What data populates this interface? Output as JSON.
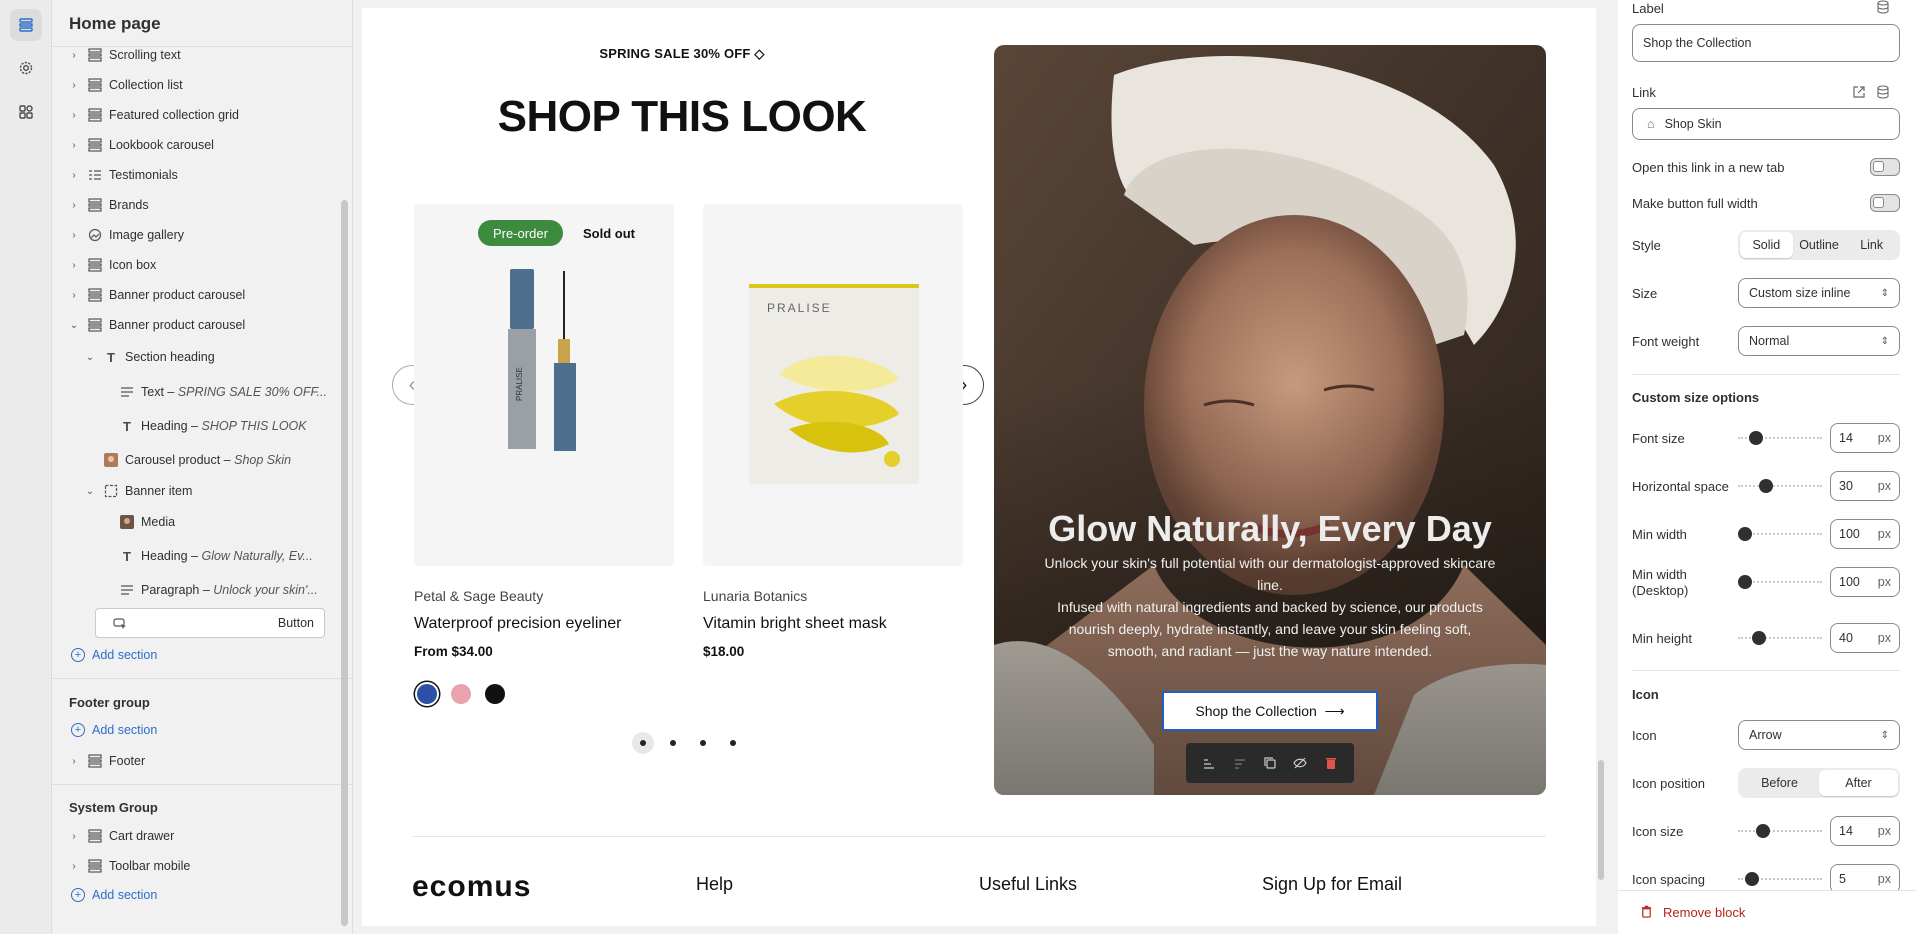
{
  "left_panel": {
    "page_title": "Home page",
    "tree": [
      {
        "label": "Scrolling text",
        "icon": "section-icon"
      },
      {
        "label": "Collection list",
        "icon": "section-icon"
      },
      {
        "label": "Featured collection grid",
        "icon": "section-icon"
      },
      {
        "label": "Lookbook carousel",
        "icon": "section-icon"
      },
      {
        "label": "Testimonials",
        "icon": "list-icon"
      },
      {
        "label": "Brands",
        "icon": "section-icon"
      },
      {
        "label": "Image gallery",
        "icon": "gallery-icon"
      },
      {
        "label": "Icon box",
        "icon": "section-icon"
      },
      {
        "label": "Banner product carousel",
        "icon": "section-icon"
      },
      {
        "label": "Banner product carousel",
        "icon": "section-icon"
      },
      {
        "label": "Section heading",
        "icon": "text-icon"
      },
      {
        "label": "Text",
        "detail": "SPRING SALE 30% OFF...",
        "icon": "paragraph-icon"
      },
      {
        "label": "Heading",
        "detail": "SHOP THIS LOOK",
        "icon": "text-icon"
      },
      {
        "label": "Carousel product",
        "detail": "Shop Skin",
        "icon": "product-thumb-icon"
      },
      {
        "label": "Banner item",
        "icon": "frame-icon"
      },
      {
        "label": "Media",
        "icon": "image-icon"
      },
      {
        "label": "Heading",
        "detail": "Glow Naturally, Ev...",
        "icon": "text-icon"
      },
      {
        "label": "Paragraph",
        "detail": "Unlock your skin'...",
        "icon": "paragraph-icon"
      },
      {
        "label": "Button",
        "icon": "button-icon"
      }
    ],
    "add_section": "Add section",
    "footer_group": {
      "title": "Footer group",
      "add_section": "Add section",
      "items": [
        "Footer"
      ]
    },
    "system_group": {
      "title": "System Group",
      "items": [
        "Cart drawer",
        "Toolbar mobile"
      ],
      "add_section": "Add section"
    }
  },
  "preview": {
    "sale_text": "SPRING SALE 30% OFF",
    "heading": "SHOP THIS LOOK",
    "products": [
      {
        "vendor": "Petal & Sage Beauty",
        "name": "Waterproof precision eyeliner",
        "price": "From $34.00",
        "badges": [
          "Pre-order",
          "Sold out"
        ],
        "swatches": [
          "#2d4fa5",
          "#e8a3ad",
          "#111111"
        ]
      },
      {
        "vendor": "Lunaria Botanics",
        "name": "Vitamin bright sheet mask",
        "price": "$18.00",
        "badges": [],
        "package_text": "PRALISE"
      }
    ],
    "eyeliner_brand": "PRALISE",
    "banner": {
      "heading": "Glow Naturally, Every Day",
      "paragraph_1": "Unlock your skin's full potential with our dermatologist-approved skincare line.",
      "paragraph_2": "Infused with natural ingredients and backed by science, our products nourish deeply, hydrate instantly, and leave your skin feeling soft, smooth, and radiant — just the way nature intended.",
      "button_label": "Shop the Collection"
    },
    "footer": {
      "logo": "ecomus",
      "columns": [
        "Help",
        "Useful Links",
        "Sign Up for Email"
      ]
    }
  },
  "settings": {
    "label_title": "Label",
    "label_value": "Shop the Collection",
    "link_title": "Link",
    "link_value": "Shop Skin",
    "new_tab": "Open this link in a new tab",
    "full_width": "Make button full width",
    "style_title": "Style",
    "style_options": [
      "Solid",
      "Outline",
      "Link"
    ],
    "style_selected": "Solid",
    "size_title": "Size",
    "size_value": "Custom size inline",
    "font_weight_title": "Font weight",
    "font_weight_value": "Normal",
    "custom_size_title": "Custom size options",
    "sliders": [
      {
        "label": "Font size",
        "value": "14",
        "unit": "px",
        "level": 0.15
      },
      {
        "label": "Horizontal space",
        "value": "30",
        "unit": "px",
        "level": 0.3
      },
      {
        "label": "Min width",
        "value": "100",
        "unit": "px",
        "level": 0.0
      },
      {
        "label": "Min width (Desktop)",
        "value": "100",
        "unit": "px",
        "level": 0.0
      },
      {
        "label": "Min height",
        "value": "40",
        "unit": "px",
        "level": 0.2
      }
    ],
    "icon_section_title": "Icon",
    "icon_title": "Icon",
    "icon_value": "Arrow",
    "icon_position_title": "Icon position",
    "icon_position_options": [
      "Before",
      "After"
    ],
    "icon_position_selected": "After",
    "icon_size": {
      "label": "Icon size",
      "value": "14",
      "unit": "px",
      "level": 0.25
    },
    "icon_spacing": {
      "label": "Icon spacing",
      "value": "5",
      "unit": "px",
      "level": 0.1
    },
    "remove_block": "Remove block"
  },
  "colors": {
    "accent": "#2c6ecb",
    "badge_green": "#3c8b3f",
    "danger": "#b42318",
    "selection_blue": "#1f5fc4"
  }
}
